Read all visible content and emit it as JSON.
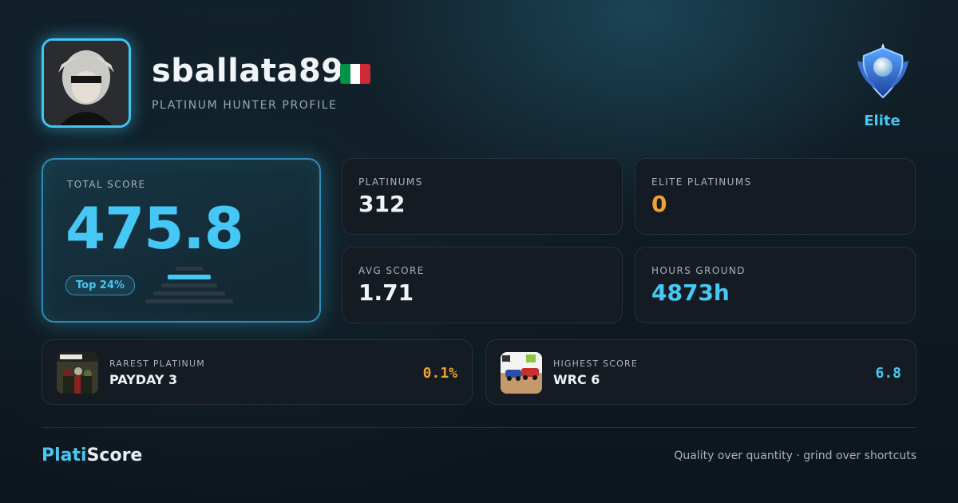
{
  "profile": {
    "username": "sballata89",
    "subtitle": "PLATINUM HUNTER PROFILE",
    "flag_colors": [
      "#009246",
      "#ffffff",
      "#ce2b37"
    ],
    "avatar_icon": "avatar-portrait",
    "tier": "Elite"
  },
  "score": {
    "label": "TOTAL SCORE",
    "value": "475.8",
    "rank": "Top 24%"
  },
  "stats": [
    {
      "label": "PLATINUMS",
      "value": "312",
      "color": "#f2f5f8"
    },
    {
      "label": "ELITE PLATINUMS",
      "value": "0",
      "color": "#f0a22e"
    },
    {
      "label": "AVG SCORE",
      "value": "1.71",
      "color": "#f2f5f8"
    },
    {
      "label": "HOURS GROUND",
      "value": "4873h",
      "color": "#45c8f5"
    }
  ],
  "rarest": {
    "label": "RAREST PLATINUM",
    "game": "PAYDAY 3",
    "value": "0.1%",
    "color": "#f0a22e"
  },
  "highest": {
    "label": "HIGHEST SCORE",
    "game": "WRC 6",
    "value": "6.8",
    "color": "#45c8f5"
  },
  "footer": {
    "brand_a": "Plati",
    "brand_b": "Score",
    "tagline": "Quality over quantity · grind over shortcuts"
  },
  "colors": {
    "accent": "#45c8f5",
    "orange": "#f0a22e",
    "card_bg": "#151b22"
  }
}
